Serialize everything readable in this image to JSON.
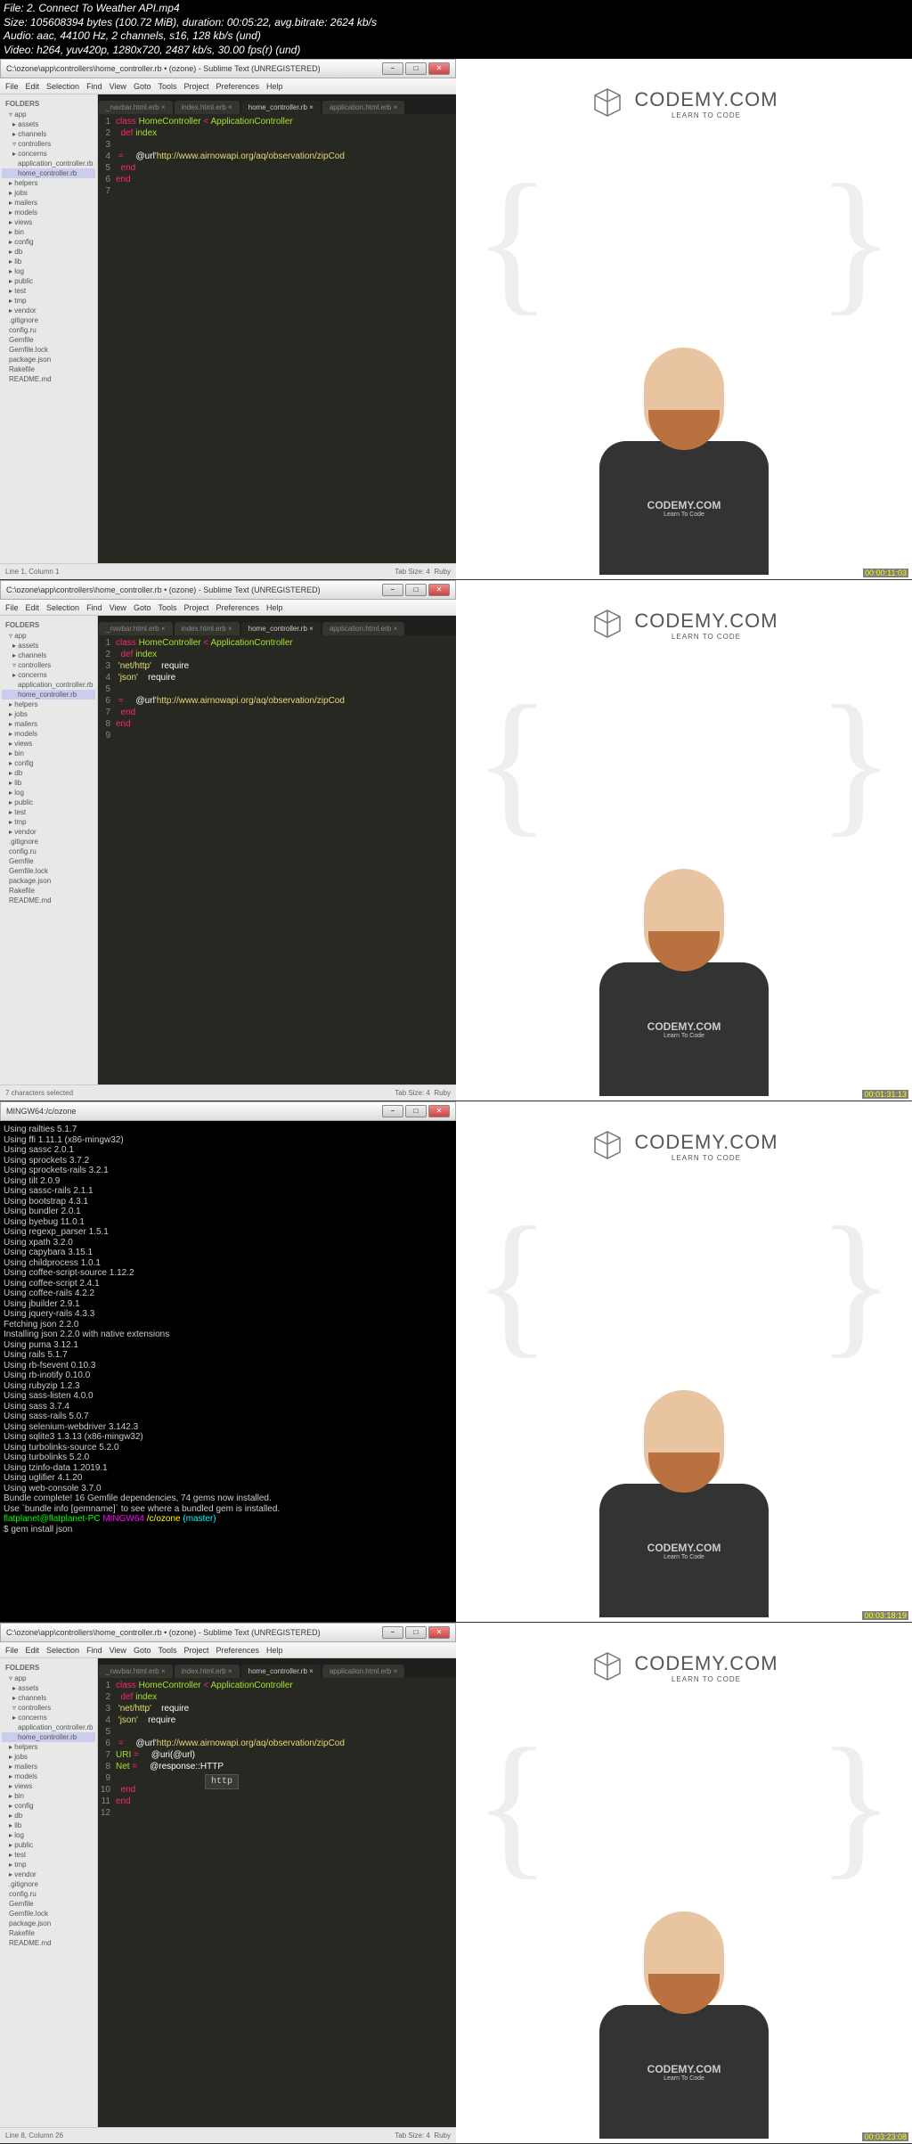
{
  "header": {
    "l1": "File: 2. Connect To Weather API.mp4",
    "l2": "Size: 105608394 bytes (100.72 MiB), duration: 00:05:22, avg.bitrate: 2624 kb/s",
    "l3": "Audio: aac, 44100 Hz, 2 channels, s16, 128 kb/s (und)",
    "l4": "Video: h264, yuv420p, 1280x720, 2487 kb/s, 30.00 fps(r) (und)"
  },
  "win": {
    "title": "C:\\ozone\\app\\controllers\\home_controller.rb • (ozone) - Sublime Text (UNREGISTERED)",
    "termtitle": "MINGW64:/c/ozone",
    "min": "−",
    "max": "□",
    "close": "✕"
  },
  "menu": {
    "m1": "File",
    "m2": "Edit",
    "m3": "Selection",
    "m4": "Find",
    "m5": "View",
    "m6": "Goto",
    "m7": "Tools",
    "m8": "Project",
    "m9": "Preferences",
    "m10": "Help"
  },
  "sidebar": {
    "h": "FOLDERS",
    "items": [
      "▿ app",
      "▸ assets",
      "▸ channels",
      "▿ controllers",
      "▸ concerns",
      "application_controller.rb",
      "home_controller.rb",
      "▸ helpers",
      "▸ jobs",
      "▸ mailers",
      "▸ models",
      "▸ views",
      "▸ bin",
      "▸ config",
      "▸ db",
      "▸ lib",
      "▸ log",
      "▸ public",
      "▸ test",
      "▸ tmp",
      "▸ vendor",
      ".gitignore",
      "config.ru",
      "Gemfile",
      "Gemfile.lock",
      "package.json",
      "Rakefile",
      "README.md"
    ]
  },
  "tabs": {
    "t1": "_navbar.html.erb",
    "t2": "index.html.erb",
    "t3": "home_controller.rb",
    "t4": "application.html.erb",
    "close": "×"
  },
  "code1": [
    {
      "n": 1,
      "kw": "class",
      "cls": " HomeController",
      "op": " < ",
      "cls2": "ApplicationController"
    },
    {
      "n": 2,
      "kw": "  def",
      "cls": " index"
    },
    {
      "n": 3,
      "txt": "    "
    },
    {
      "n": 4,
      "var": "    @url",
      "op": " = ",
      "str": "'http://www.airnowapi.org/aq/observation/zipCod"
    },
    {
      "n": 5,
      "kw": "  end"
    },
    {
      "n": 6,
      "kw": "end"
    },
    {
      "n": 7,
      "txt": ""
    }
  ],
  "code2": [
    {
      "n": 1,
      "kw": "class",
      "cls": " HomeController",
      "op": " < ",
      "cls2": "ApplicationController"
    },
    {
      "n": 2,
      "kw": "  def",
      "cls": " index"
    },
    {
      "n": 3,
      "txt": "    require",
      "str": " 'net/http'"
    },
    {
      "n": 4,
      "txt": "    require",
      "str": " 'json'"
    },
    {
      "n": 5,
      "txt": ""
    },
    {
      "n": 6,
      "var": "    @url",
      "op": " = ",
      "str": "'http://www.airnowapi.org/aq/observation/zipCod"
    },
    {
      "n": 7,
      "kw": "  end"
    },
    {
      "n": 8,
      "kw": "end"
    },
    {
      "n": 9,
      "txt": ""
    }
  ],
  "code4": [
    {
      "n": 1,
      "kw": "class",
      "cls": " HomeController",
      "op": " < ",
      "cls2": "ApplicationController"
    },
    {
      "n": 2,
      "kw": "  def",
      "cls": " index"
    },
    {
      "n": 3,
      "txt": "    require",
      "str": " 'net/http'"
    },
    {
      "n": 4,
      "txt": "    require",
      "str": " 'json'"
    },
    {
      "n": 5,
      "txt": ""
    },
    {
      "n": 6,
      "var": "    @url",
      "op": " = ",
      "str": "'http://www.airnowapi.org/aq/observation/zipCod"
    },
    {
      "n": 7,
      "var": "    @uri",
      "op": " = ",
      "cls": "URI",
      "txt2": "(@url)"
    },
    {
      "n": 8,
      "var": "    @response",
      "op": " = ",
      "cls": "Net",
      "txt2": "::HTTP"
    },
    {
      "n": 9,
      "txt": ""
    },
    {
      "n": 10,
      "kw": "  end"
    },
    {
      "n": 11,
      "kw": "end"
    },
    {
      "n": 12,
      "txt": ""
    }
  ],
  "autocomplete": "http",
  "status": {
    "left1": "Line 1, Column 1",
    "left2": "7 characters selected",
    "left4": "Line 8, Column 26",
    "tab": "Tab Size: 4",
    "lang": "Ruby"
  },
  "logo": {
    "brand": "CODEMY.COM",
    "sub": "LEARN TO CODE"
  },
  "shirt": {
    "a": "CODEMY.COM",
    "b": "Learn To Code"
  },
  "ts": {
    "t1": "00:00:11:03",
    "t2": "00:01:31:13",
    "t3": "00:03:18:19",
    "t4": "00:03:23:08"
  },
  "terminal": [
    "Using railties 5.1.7",
    "Using ffi 1.11.1 (x86-mingw32)",
    "Using sassc 2.0.1",
    "Using sprockets 3.7.2",
    "Using sprockets-rails 3.2.1",
    "Using tilt 2.0.9",
    "Using sassc-rails 2.1.1",
    "Using bootstrap 4.3.1",
    "Using bundler 2.0.1",
    "Using byebug 11.0.1",
    "Using regexp_parser 1.5.1",
    "Using xpath 3.2.0",
    "Using capybara 3.15.1",
    "Using childprocess 1.0.1",
    "Using coffee-script-source 1.12.2",
    "Using coffee-script 2.4.1",
    "Using coffee-rails 4.2.2",
    "Using jbuilder 2.9.1",
    "Using jquery-rails 4.3.3",
    "Fetching json 2.2.0",
    "Installing json 2.2.0 with native extensions",
    "Using puma 3.12.1",
    "Using rails 5.1.7",
    "Using rb-fsevent 0.10.3",
    "Using rb-inotify 0.10.0",
    "Using rubyzip 1.2.3",
    "Using sass-listen 4.0.0",
    "Using sass 3.7.4",
    "Using sass-rails 5.0.7",
    "Using selenium-webdriver 3.142.3",
    "Using sqlite3 1.3.13 (x86-mingw32)",
    "Using turbolinks-source 5.2.0",
    "Using turbolinks 5.2.0",
    "Using tzinfo-data 1.2019.1",
    "Using uglifier 4.1.20",
    "Using web-console 3.7.0",
    "Bundle complete! 16 Gemfile dependencies, 74 gems now installed.",
    "Use `bundle info [gemname]` to see where a bundled gem is installed."
  ],
  "prompt": {
    "user": "flatplanet@flatplanet-PC",
    "env": " MINGW64 ",
    "path": "/c/ozone",
    "branch": " (master)",
    "cmd": "$ gem install json"
  }
}
